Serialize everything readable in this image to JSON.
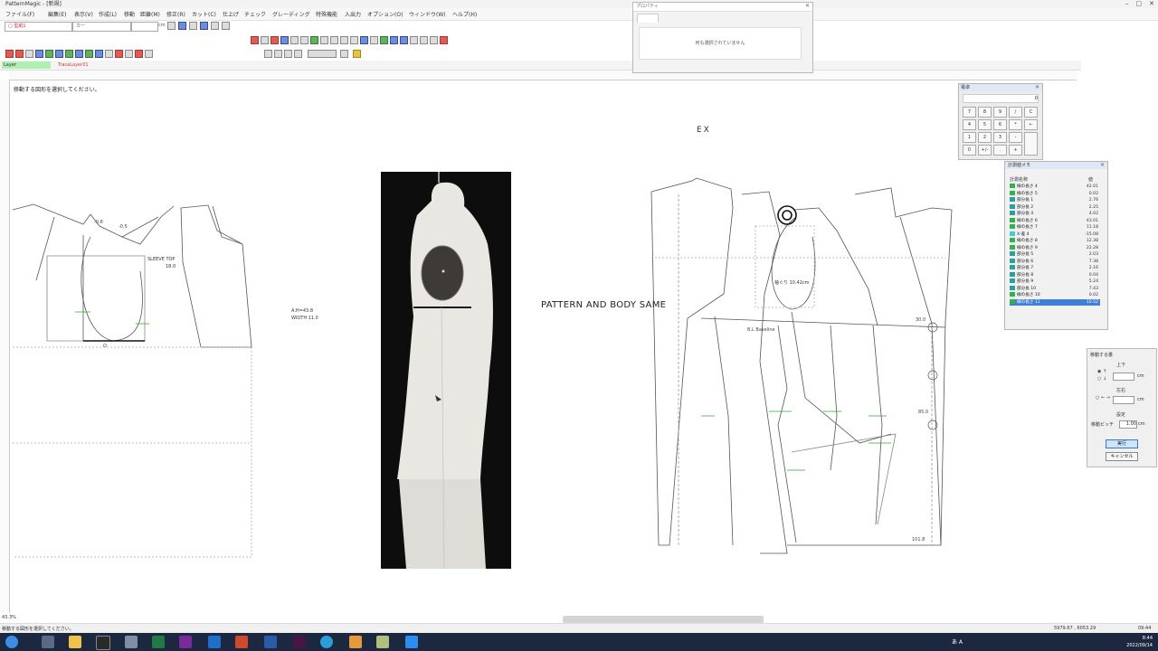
{
  "window": {
    "title": "PatternMagic - [新規]"
  },
  "menu": [
    "ファイル(F)",
    "編集(E)",
    "表示(V)",
    "作成(L)",
    "移動",
    "距離(M)",
    "修正(R)",
    "カット(C)",
    "仕上げ",
    "チェック",
    "グレーディング",
    "特殊機能",
    "入出力",
    "オプション(O)",
    "ウィンドウ(W)",
    "ヘルプ(H)"
  ],
  "toolbar": {
    "pattern_dropdown": "▢ 型紙1",
    "size_dropdown": "カー",
    "unit": "cm"
  },
  "layer": {
    "name": "Layer",
    "trace_layer": "TraceLayer01"
  },
  "canvas": {
    "status_message": "移動する図形を選択してください。",
    "pattern_text": "PATTERN AND BODY SAME",
    "ex_text": "EX",
    "armhole_label": "袖ぐり 10.42cm",
    "sleeve_top_label": "SLEEVE TOP",
    "sleeve_top_value": "18.0",
    "ah_label": "A.H=43.8",
    "width_label": "WIDTH 11.0",
    "bl_label": "B.L  Baseline",
    "val_minus0_8": "-0.8",
    "val_minus0_5": "-0.5",
    "val_30": "30.0",
    "val_85": "85.0",
    "val_101": "101.8",
    "val_o": "O"
  },
  "properties": {
    "title": "プロパティ",
    "message": "何も選択されていません"
  },
  "calculator": {
    "title": "電卓",
    "display": "0",
    "keys": [
      "7",
      "8",
      "9",
      "/",
      "C",
      "4",
      "5",
      "6",
      "*",
      "←",
      "1",
      "2",
      "3",
      "-",
      "",
      "0",
      "+/-",
      ".",
      "+",
      ""
    ]
  },
  "measure": {
    "title": "計測値メモ",
    "col_name": "計測名称",
    "col_value": "値",
    "rows": [
      {
        "name": "線の長さ 4",
        "value": "42.01",
        "color": "#2fb34a",
        "selected": false
      },
      {
        "name": "線の長さ 5",
        "value": "0.02",
        "color": "#2fb34a",
        "selected": false
      },
      {
        "name": "部分長 1",
        "value": "2.76",
        "color": "#2aa0a0",
        "selected": false
      },
      {
        "name": "部分長 2",
        "value": "2.25",
        "color": "#2aa0a0",
        "selected": false
      },
      {
        "name": "部分長 4",
        "value": "4.02",
        "color": "#2aa0a0",
        "selected": false
      },
      {
        "name": "線の長さ 6",
        "value": "43.01",
        "color": "#2fb34a",
        "selected": false
      },
      {
        "name": "線の長さ 7",
        "value": "11.18",
        "color": "#2fb34a",
        "selected": false
      },
      {
        "name": "X-差 4",
        "value": "-15.08",
        "color": "#47c7e0",
        "selected": false
      },
      {
        "name": "線の長さ 8",
        "value": "12.38",
        "color": "#2fb34a",
        "selected": false
      },
      {
        "name": "線の長さ 9",
        "value": "22.28",
        "color": "#2fb34a",
        "selected": false
      },
      {
        "name": "部分長 5",
        "value": "2.03",
        "color": "#2aa0a0",
        "selected": false
      },
      {
        "name": "部分長 6",
        "value": "7.38",
        "color": "#2aa0a0",
        "selected": false
      },
      {
        "name": "部分長 7",
        "value": "2.16",
        "color": "#2aa0a0",
        "selected": false
      },
      {
        "name": "部分長 8",
        "value": "0.04",
        "color": "#2aa0a0",
        "selected": false
      },
      {
        "name": "部分長 9",
        "value": "5.24",
        "color": "#2aa0a0",
        "selected": false
      },
      {
        "name": "部分長 10",
        "value": "7.43",
        "color": "#2aa0a0",
        "selected": false
      },
      {
        "name": "線の長さ 10",
        "value": "0.02",
        "color": "#2fb34a",
        "selected": false
      },
      {
        "name": "線の長さ 11",
        "value": "10.52",
        "color": "#2fb34a",
        "selected": true
      }
    ]
  },
  "move_panel": {
    "title": "移動する量",
    "updown_label": "上下",
    "up": "↑",
    "down": "↓",
    "leftright_label": "左右",
    "left": "←",
    "right": "→",
    "setting_label": "設定",
    "pitch_label": "移動ピッチ",
    "pitch_value": "1.00",
    "unit": "cm",
    "ok_label": "実行",
    "cancel_label": "キャンセル"
  },
  "zoom": {
    "value": "43.3%"
  },
  "statusbar": {
    "message": "移動する図形を選択してください。",
    "coords": "5979.67 , 6053.29",
    "time": "09:44"
  },
  "taskbar": {
    "ime": "あ A",
    "time": "8:44",
    "date": "2022/09/14"
  }
}
